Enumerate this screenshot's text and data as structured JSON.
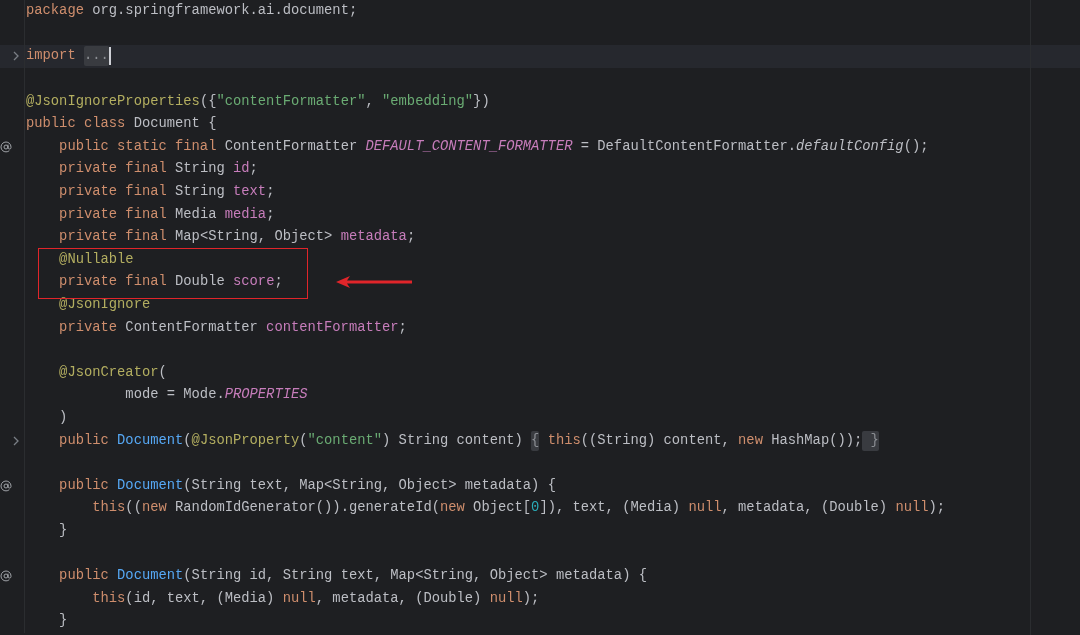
{
  "editor": {
    "lines": [
      {
        "kind": "code",
        "current": false,
        "tokens": [
          {
            "kind": "kw",
            "text": "package"
          },
          {
            "kind": "plain",
            "text": " org.springframework.ai.document;"
          }
        ]
      },
      {
        "kind": "blank",
        "current": false
      },
      {
        "kind": "code",
        "current": true,
        "gutter": {
          "kind": "fold"
        },
        "tokens": [
          {
            "kind": "kw",
            "text": "import "
          },
          {
            "kind": "folded",
            "text": "..."
          }
        ]
      },
      {
        "kind": "blank",
        "current": false
      },
      {
        "kind": "code",
        "current": false,
        "tokens": [
          {
            "kind": "ann",
            "text": "@JsonIgnoreProperties"
          },
          {
            "kind": "plain",
            "text": "({"
          },
          {
            "kind": "str",
            "text": "\"contentFormatter\""
          },
          {
            "kind": "plain",
            "text": ", "
          },
          {
            "kind": "str",
            "text": "\"embedding\""
          },
          {
            "kind": "plain",
            "text": "})"
          }
        ]
      },
      {
        "kind": "code",
        "current": false,
        "tokens": [
          {
            "kind": "kw",
            "text": "public class"
          },
          {
            "kind": "plain",
            "text": " Document {"
          }
        ]
      },
      {
        "kind": "code",
        "current": false,
        "gutter": {
          "kind": "at"
        },
        "tokens": [
          {
            "kind": "kw",
            "text": "    public static final"
          },
          {
            "kind": "plain",
            "text": " ContentFormatter "
          },
          {
            "kind": "static",
            "text": "DEFAULT_CONTENT_FORMATTER"
          },
          {
            "kind": "plain",
            "text": " = DefaultContentFormatter."
          },
          {
            "kind": "call",
            "text": "defaultConfig"
          },
          {
            "kind": "plain",
            "text": "();"
          }
        ]
      },
      {
        "kind": "code",
        "current": false,
        "tokens": [
          {
            "kind": "kw",
            "text": "    private final"
          },
          {
            "kind": "plain",
            "text": " String "
          },
          {
            "kind": "field",
            "text": "id"
          },
          {
            "kind": "plain",
            "text": ";"
          }
        ]
      },
      {
        "kind": "code",
        "current": false,
        "tokens": [
          {
            "kind": "kw",
            "text": "    private final"
          },
          {
            "kind": "plain",
            "text": " String "
          },
          {
            "kind": "field",
            "text": "text"
          },
          {
            "kind": "plain",
            "text": ";"
          }
        ]
      },
      {
        "kind": "code",
        "current": false,
        "tokens": [
          {
            "kind": "kw",
            "text": "    private final"
          },
          {
            "kind": "plain",
            "text": " Media "
          },
          {
            "kind": "field",
            "text": "media"
          },
          {
            "kind": "plain",
            "text": ";"
          }
        ]
      },
      {
        "kind": "code",
        "current": false,
        "tokens": [
          {
            "kind": "kw",
            "text": "    private final"
          },
          {
            "kind": "plain",
            "text": " Map<String, Object> "
          },
          {
            "kind": "field",
            "text": "metadata"
          },
          {
            "kind": "plain",
            "text": ";"
          }
        ]
      },
      {
        "kind": "callout",
        "lines": [
          {
            "kind": "code",
            "current": false,
            "tokens": [
              {
                "kind": "ann",
                "text": "    @Nullable"
              }
            ]
          },
          {
            "kind": "code",
            "current": false,
            "tokens": [
              {
                "kind": "kw",
                "text": "    private final"
              },
              {
                "kind": "plain",
                "text": " Double "
              },
              {
                "kind": "field",
                "text": "score"
              },
              {
                "kind": "plain",
                "text": ";"
              }
            ]
          }
        ]
      },
      {
        "kind": "code",
        "current": false,
        "tokens": [
          {
            "kind": "ann",
            "text": "    @JsonIgnore"
          }
        ]
      },
      {
        "kind": "code",
        "current": false,
        "tokens": [
          {
            "kind": "kw",
            "text": "    private"
          },
          {
            "kind": "plain",
            "text": " ContentFormatter "
          },
          {
            "kind": "field",
            "text": "contentFormatter"
          },
          {
            "kind": "plain",
            "text": ";"
          }
        ]
      },
      {
        "kind": "blank",
        "current": false
      },
      {
        "kind": "code",
        "current": false,
        "tokens": [
          {
            "kind": "ann",
            "text": "    @JsonCreator"
          },
          {
            "kind": "plain",
            "text": "("
          }
        ]
      },
      {
        "kind": "code",
        "current": false,
        "tokens": [
          {
            "kind": "plain",
            "text": "            mode = Mode."
          },
          {
            "kind": "static",
            "text": "PROPERTIES"
          }
        ]
      },
      {
        "kind": "code",
        "current": false,
        "tokens": [
          {
            "kind": "plain",
            "text": "    )"
          }
        ]
      },
      {
        "kind": "code",
        "current": false,
        "gutter": {
          "kind": "fold"
        },
        "tokens": [
          {
            "kind": "kw",
            "text": "    public "
          },
          {
            "kind": "method",
            "text": "Document"
          },
          {
            "kind": "plain",
            "text": "("
          },
          {
            "kind": "ann",
            "text": "@JsonProperty"
          },
          {
            "kind": "plain",
            "text": "("
          },
          {
            "kind": "str",
            "text": "\"content\""
          },
          {
            "kind": "plain",
            "text": ") String content) "
          },
          {
            "kind": "folded",
            "text": "{"
          },
          {
            "kind": "kw",
            "text": " this"
          },
          {
            "kind": "plain",
            "text": "((String) content, "
          },
          {
            "kind": "kw",
            "text": "new"
          },
          {
            "kind": "plain",
            "text": " HashMap());"
          },
          {
            "kind": "folded",
            "text": " }"
          }
        ]
      },
      {
        "kind": "blank",
        "current": false
      },
      {
        "kind": "code",
        "current": false,
        "gutter": {
          "kind": "at"
        },
        "tokens": [
          {
            "kind": "kw",
            "text": "    public "
          },
          {
            "kind": "method",
            "text": "Document"
          },
          {
            "kind": "plain",
            "text": "(String text, Map<String, Object> metadata) {"
          }
        ]
      },
      {
        "kind": "code",
        "current": false,
        "tokens": [
          {
            "kind": "kw",
            "text": "        this"
          },
          {
            "kind": "plain",
            "text": "(("
          },
          {
            "kind": "kw",
            "text": "new"
          },
          {
            "kind": "plain",
            "text": " RandomIdGenerator()).generateId("
          },
          {
            "kind": "kw",
            "text": "new"
          },
          {
            "kind": "plain",
            "text": " Object["
          },
          {
            "kind": "num",
            "text": "0"
          },
          {
            "kind": "plain",
            "text": "]), text, (Media) "
          },
          {
            "kind": "kw",
            "text": "null"
          },
          {
            "kind": "plain",
            "text": ", metadata, (Double) "
          },
          {
            "kind": "kw",
            "text": "null"
          },
          {
            "kind": "plain",
            "text": ");"
          }
        ]
      },
      {
        "kind": "code",
        "current": false,
        "tokens": [
          {
            "kind": "plain",
            "text": "    }"
          }
        ]
      },
      {
        "kind": "blank",
        "current": false
      },
      {
        "kind": "code",
        "current": false,
        "gutter": {
          "kind": "at"
        },
        "tokens": [
          {
            "kind": "kw",
            "text": "    public "
          },
          {
            "kind": "method",
            "text": "Document"
          },
          {
            "kind": "plain",
            "text": "(String id, String text, Map<String, Object> metadata) {"
          }
        ]
      },
      {
        "kind": "code",
        "current": false,
        "tokens": [
          {
            "kind": "kw",
            "text": "        this"
          },
          {
            "kind": "plain",
            "text": "(id, text, (Media) "
          },
          {
            "kind": "kw",
            "text": "null"
          },
          {
            "kind": "plain",
            "text": ", metadata, (Double) "
          },
          {
            "kind": "kw",
            "text": "null"
          },
          {
            "kind": "plain",
            "text": ");"
          }
        ]
      },
      {
        "kind": "code",
        "current": false,
        "tokens": [
          {
            "kind": "plain",
            "text": "    }"
          }
        ]
      }
    ]
  }
}
